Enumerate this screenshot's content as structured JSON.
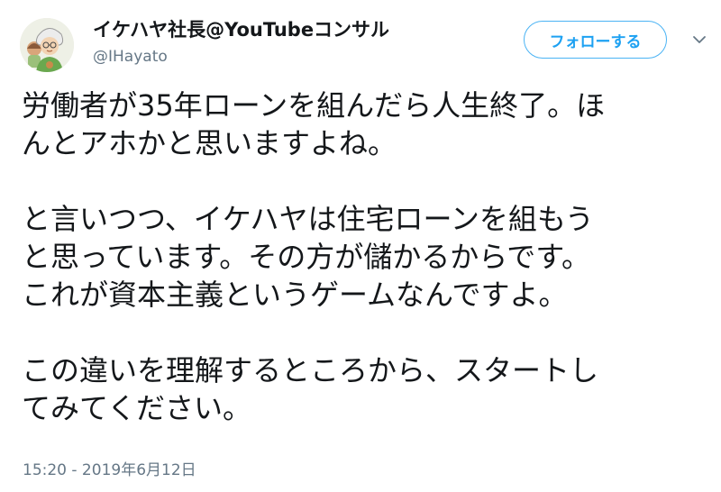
{
  "tweet": {
    "author": {
      "display_name": "イケハヤ社長@YouTubeコンサル",
      "handle": "@IHayato"
    },
    "follow_label": "フォローする",
    "body": [
      [
        "労働者が35年ローンを組んだら人生終了。ほ",
        "んとアホかと思いますよね。"
      ],
      [
        "と言いつつ、イケハヤは住宅ローンを組もう",
        "と思っています。その方が儲かるからです。",
        "これが資本主義というゲームなんですよ。"
      ],
      [
        "この違いを理解するところから、スタートし",
        "てみてください。"
      ]
    ],
    "timestamp": "15:20 - 2019年6月12日",
    "colors": {
      "accent": "#1da1f2",
      "secondary_text": "#657786",
      "primary_text": "#14171a"
    },
    "icons": {
      "more": "chevron-down-icon",
      "avatar": "avatar"
    }
  }
}
